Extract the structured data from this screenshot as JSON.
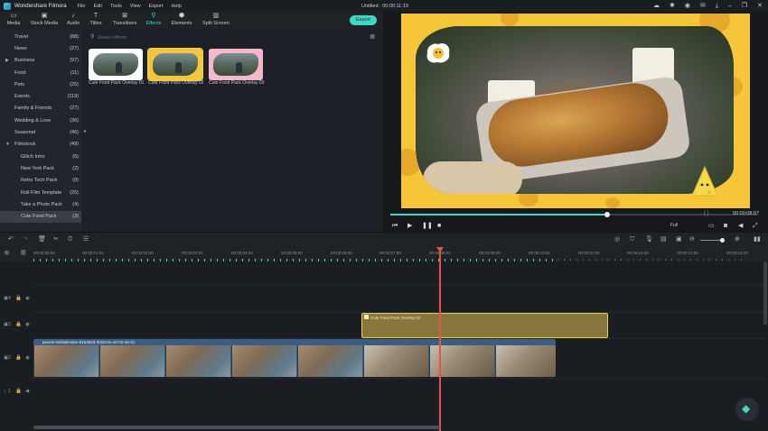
{
  "app": {
    "name": "Wondershare Filmora",
    "menu": [
      "File",
      "Edit",
      "Tools",
      "View",
      "Export",
      "Help"
    ],
    "project_title": "Untitled : 00:00:11:19"
  },
  "tabs": [
    {
      "label": "Media",
      "icon": "folder-icon"
    },
    {
      "label": "Stock Media",
      "icon": "stock-media-icon"
    },
    {
      "label": "Audio",
      "icon": "music-note-icon"
    },
    {
      "label": "Titles",
      "icon": "text-icon"
    },
    {
      "label": "Transitions",
      "icon": "transitions-icon"
    },
    {
      "label": "Effects",
      "icon": "effects-icon",
      "active": true
    },
    {
      "label": "Elements",
      "icon": "elements-icon"
    },
    {
      "label": "Split Screen",
      "icon": "split-screen-icon"
    }
  ],
  "export_label": "Export",
  "categories": [
    {
      "name": "Travel",
      "count": "(88)"
    },
    {
      "name": "News",
      "count": "(27)"
    },
    {
      "name": "Business",
      "count": "(97)",
      "expandable": true
    },
    {
      "name": "Food",
      "count": "(11)"
    },
    {
      "name": "Pets",
      "count": "(25)"
    },
    {
      "name": "Events",
      "count": "(119)"
    },
    {
      "name": "Family & Friends",
      "count": "(27)"
    },
    {
      "name": "Wedding & Love",
      "count": "(36)"
    },
    {
      "name": "Seasonal",
      "count": "(46)"
    },
    {
      "name": "Filmstock",
      "count": "(49)",
      "expanded": true
    },
    {
      "name": "Glitch Intro",
      "count": "(6)",
      "sub": true
    },
    {
      "name": "New York Pack",
      "count": "(2)",
      "sub": true
    },
    {
      "name": "Retro Tech Pack",
      "count": "(9)",
      "sub": true
    },
    {
      "name": "Roll Film Template",
      "count": "(25)",
      "sub": true
    },
    {
      "name": "Take a Photo Pack",
      "count": "(4)",
      "sub": true
    },
    {
      "name": "Cute Food Pack",
      "count": "(3)",
      "sub": true,
      "selected": true
    }
  ],
  "search": {
    "placeholder": "Search effects"
  },
  "effects": [
    {
      "label": "Cute Food Pack Overlay 01",
      "bg": "#ffffff"
    },
    {
      "label": "Cute Food Pack Overlay 02",
      "bg": "#f5c63a",
      "selected": true
    },
    {
      "label": "Cute Food Pack Overlay 03",
      "bg": "#f4b8c8"
    }
  ],
  "preview": {
    "current_time": "00:00:08:07",
    "quality": "Full",
    "progress": 0.59
  },
  "timeline": {
    "ruler_labels": [
      "00:00:00:00",
      "00:00:01:00",
      "00:00:02:00",
      "00:00:03:00",
      "00:00:04:00",
      "00:00:05:00",
      "00:00:06:00",
      "00:00:07:00",
      "00:00:08:00",
      "00:00:09:00",
      "00:00:10:00",
      "00:00:11:00",
      "00:00:12:00",
      "00:00:13:00",
      "00:00:14:00"
    ],
    "track_numbers": [
      "4",
      "3",
      "2",
      "1"
    ],
    "overlay_clip_label": "Cute Food Pack Overlay 02",
    "video_clip_label": "pexels-mikhail-nilov-8153943-2015-01-10-22-34-31"
  },
  "colors": {
    "accent": "#3fd6c4",
    "playhead": "#e8524a",
    "selection": "#e8d44a",
    "overlay_clip": "#87773c",
    "video_clip": "#3b5d83",
    "preview_frame": "#f5c63a"
  }
}
